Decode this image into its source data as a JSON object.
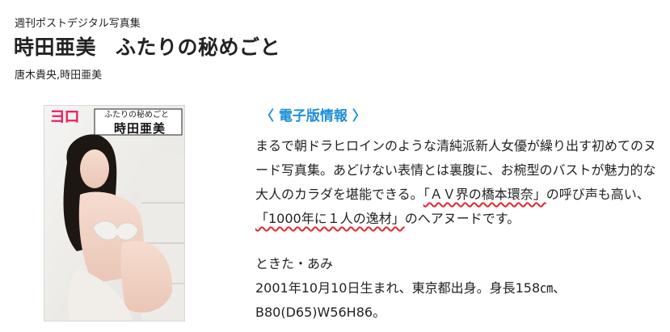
{
  "header": {
    "series": "週刊ポストデジタル写真集",
    "title_main": "時田亜美",
    "title_sub": "ふたりの秘めごと",
    "authors": "唐木貴央,時田亜美"
  },
  "cover": {
    "logo_text": "ヨロ",
    "cover_subtitle": "ふたりの秘めごと",
    "cover_name": "時田亜美"
  },
  "info": {
    "heading": "〈 電子版情報 〉",
    "desc_line1": "まるで朝ドラヒロインのような清純派新人女優が繰り出す初めてのヌ",
    "desc_line2": "ード写真集。あどけない表情とは裏腹に、お椀型のバストが魅力的な",
    "desc_line3_pre": "大人のカラダを堪能できる。",
    "desc_line3_highlight": "「ＡＶ界の橋本環奈」",
    "desc_line3_post": "の呼び声も高い、",
    "desc_line4_highlight": "「1000年に１人の逸材」",
    "desc_line4_post": "のへアヌードです。"
  },
  "profile": {
    "name_reading": "ときた・あみ",
    "birth": "2001年10月10日生まれ、東京都出身。身長158㎝、",
    "measurements": "B80(D65)W56H86。"
  },
  "colors": {
    "accent": "#1e8fd6",
    "underline": "#e3282b",
    "cover_logo": "#e8246a"
  }
}
